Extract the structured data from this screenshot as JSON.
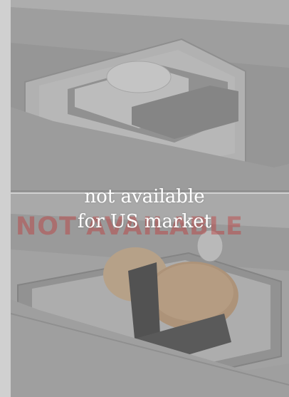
{
  "overlay": {
    "line1": "not available",
    "line2": "for US market",
    "badge": "NOT AVAILABLE"
  },
  "colors": {
    "veil": "#8a8a8a",
    "text": "#ffffff",
    "badge": "#c44b4b"
  }
}
